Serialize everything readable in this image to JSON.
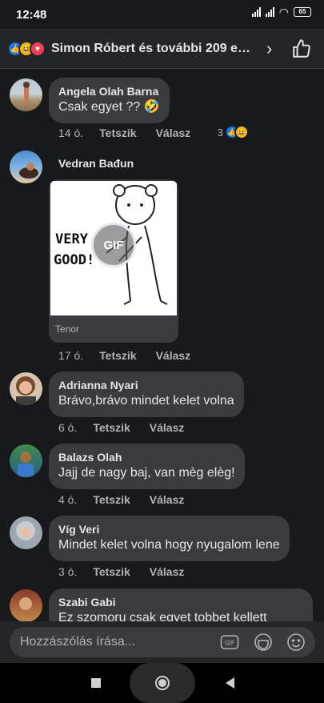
{
  "status": {
    "time": "12:48",
    "battery": "65"
  },
  "header": {
    "title": "Simon Róbert és további 209 em…",
    "reaction_icons": [
      "like-icon",
      "haha-icon",
      "love-icon"
    ]
  },
  "comments": [
    {
      "name": "Angela Olah Barna",
      "text": "Csak egyet ?? 🤣",
      "time": "14 ó.",
      "like": "Tetszik",
      "reply": "Válasz",
      "reaction_count": "3"
    },
    {
      "name": "Vedran Bađun",
      "gif_source": "Tenor",
      "gif_label": "GIF",
      "gif_text": "VERY GOOD!",
      "time": "17 ó.",
      "like": "Tetszik",
      "reply": "Válasz"
    },
    {
      "name": "Adrianna Nyari",
      "text": "Brávo,brávo mindet kelet volna",
      "time": "6 ó.",
      "like": "Tetszik",
      "reply": "Válasz"
    },
    {
      "name": "Balazs Olah",
      "text": "Jajj de nagy baj, van mèg elèg!",
      "time": "4 ó.",
      "like": "Tetszik",
      "reply": "Válasz"
    },
    {
      "name": "Víg Veri",
      "text": "Mindet kelet volna hogy nyugalom lene",
      "time": "3 ó.",
      "like": "Tetszik",
      "reply": "Válasz"
    },
    {
      "name": "Szabi Gabi",
      "text": "Ez szomoru csak egyet tobbet kellett"
    }
  ],
  "composer": {
    "placeholder": "Hozzászólás írása...",
    "gif_label": "GIF"
  },
  "colors": {
    "background": "#18191a",
    "bubble": "#3a3b3c",
    "accent": "#1877f2"
  }
}
